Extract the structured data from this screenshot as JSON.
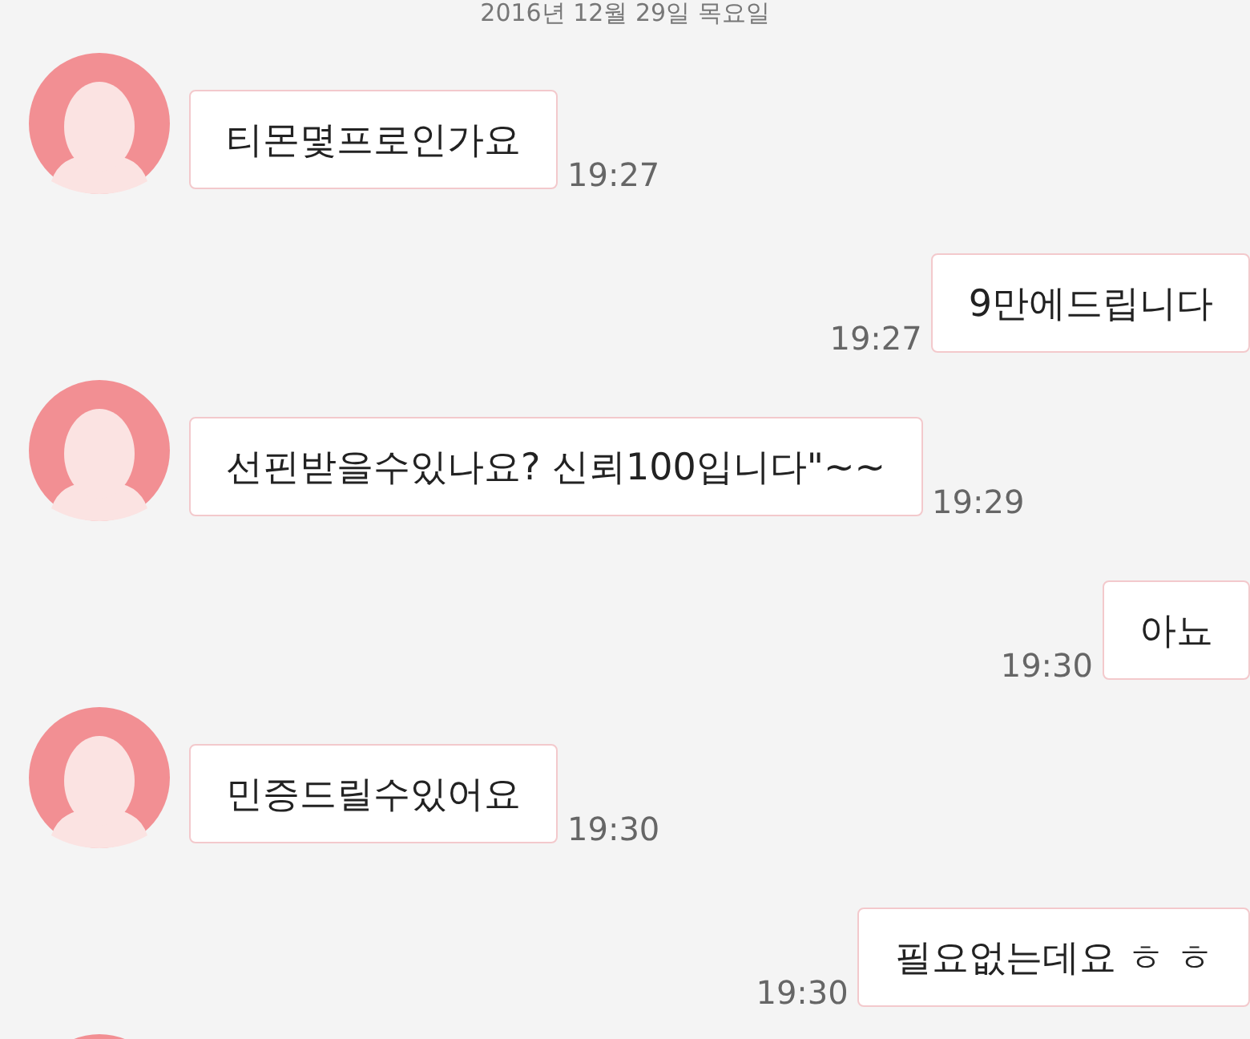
{
  "date_divider": "2016년 12월 29일 목요일",
  "messages": [
    {
      "kind": "incoming",
      "text": "티몬몇프로인가요",
      "time": "19:27"
    },
    {
      "kind": "outgoing",
      "text": "9만에드립니다",
      "time": "19:27"
    },
    {
      "kind": "incoming",
      "text": "선핀받을수있나요? 신뢰100입니다\"~~",
      "time": "19:29"
    },
    {
      "kind": "outgoing",
      "text": "아뇨",
      "time": "19:30"
    },
    {
      "kind": "incoming",
      "text": "민증드릴수있어요",
      "time": "19:30"
    },
    {
      "kind": "outgoing",
      "text": "필요없는데요 ㅎ ㅎ",
      "time": "19:30"
    },
    {
      "kind": "incoming_partial"
    }
  ]
}
